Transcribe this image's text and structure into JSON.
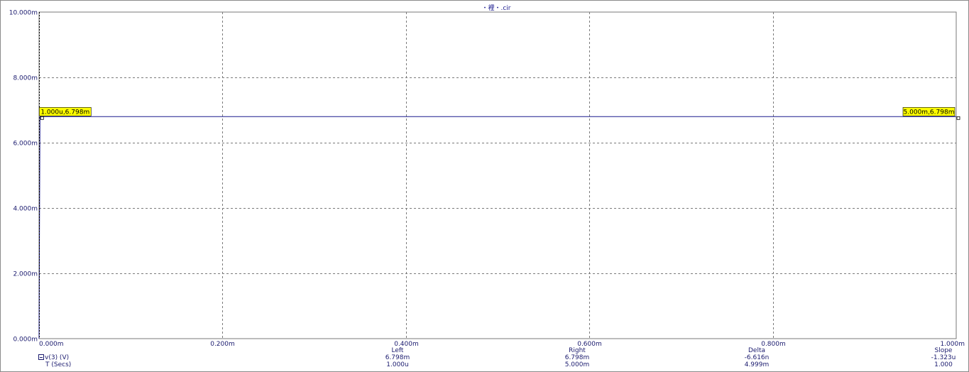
{
  "chart_data": {
    "type": "line",
    "title": "・裡・.cir",
    "xlabel": "T (Secs)",
    "ylabel": "",
    "xlim": [
      0,
      0.001
    ],
    "ylim": [
      0,
      0.01
    ],
    "x_ticks": [
      {
        "value": 0,
        "label": "0.000m"
      },
      {
        "value": 0.0002,
        "label": "0.200m"
      },
      {
        "value": 0.0004,
        "label": "0.400m"
      },
      {
        "value": 0.0006,
        "label": "0.600m"
      },
      {
        "value": 0.0008,
        "label": "0.800m"
      },
      {
        "value": 0.001,
        "label": "1.000m"
      }
    ],
    "y_ticks": [
      {
        "value": 0,
        "label": "0.000m"
      },
      {
        "value": 0.002,
        "label": "2.000m"
      },
      {
        "value": 0.004,
        "label": "4.000m"
      },
      {
        "value": 0.006,
        "label": "6.000m"
      },
      {
        "value": 0.008,
        "label": "8.000m"
      },
      {
        "value": 0.01,
        "label": "10.000m"
      }
    ],
    "grid": true,
    "series": [
      {
        "name": "v(3) (V)",
        "color": "#1a1a8e",
        "x": [
          0,
          1e-06,
          0.001
        ],
        "y": [
          0.0,
          0.006798,
          0.006798
        ]
      }
    ],
    "cursors": [
      {
        "x": 1e-06,
        "y": 0.006798,
        "label": "1.000u,6.798m",
        "side": "left"
      },
      {
        "x": 0.001,
        "y": 0.006798,
        "label": "5.000m,6.798m",
        "side": "right"
      }
    ]
  },
  "legend": {
    "y_name": "v(3) (V)",
    "x_name": "T (Secs)"
  },
  "stats": [
    {
      "header": "Left",
      "row1": "6.798m",
      "row2": "1.000u"
    },
    {
      "header": "Right",
      "row1": "6.798m",
      "row2": "5.000m"
    },
    {
      "header": "Delta",
      "row1": "-6.616n",
      "row2": "4.999m"
    },
    {
      "header": "Slope",
      "row1": "-1.323u",
      "row2": "1.000"
    }
  ],
  "colors": {
    "trace": "#1a1a8e",
    "grid": "#7a7a7a",
    "cursor_label_bg": "#ffff00",
    "text": "#1a1a6e"
  }
}
